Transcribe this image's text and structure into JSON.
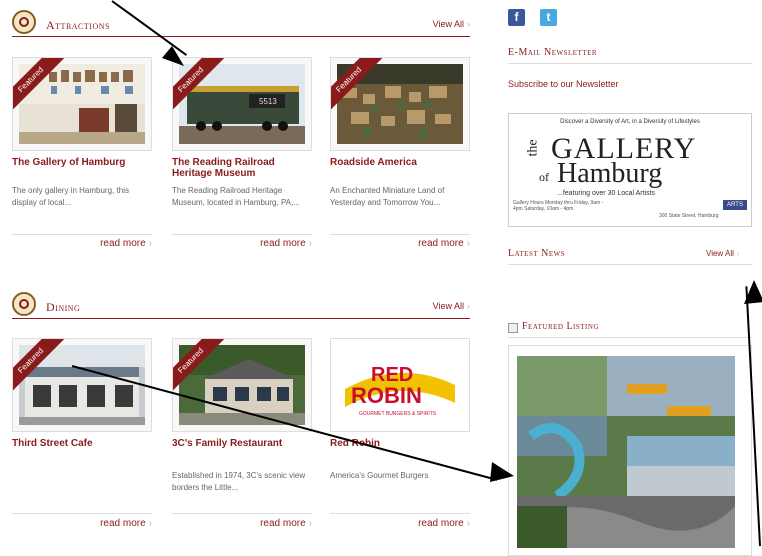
{
  "attractions": {
    "title": "Attractions",
    "view_all": "View All",
    "items": [
      {
        "badge": "Featured",
        "title": "The Gallery of Hamburg",
        "desc": "The only gallery in Hamburg, this display of local...",
        "read_more": "read more"
      },
      {
        "badge": "Featured",
        "title": "The Reading Railroad Heritage Museum",
        "desc": "The Reading Railroad Heritage Museum, located in Hamburg, PA,...",
        "read_more": "read more",
        "engine_number": "5513"
      },
      {
        "badge": "Featured",
        "title": "Roadside America",
        "desc": "An Enchanted Miniature Land of Yesterday and Tomorrow You...",
        "read_more": "read more"
      }
    ]
  },
  "dining": {
    "title": "Dining",
    "view_all": "View All",
    "items": [
      {
        "badge": "Featured",
        "title": "Third Street Cafe",
        "desc": "",
        "read_more": "read more"
      },
      {
        "badge": "Featured",
        "title": "3C's Family Restaurant",
        "desc": "Established in 1974, 3C's scenic view borders the Little...",
        "read_more": "read more"
      },
      {
        "badge": "",
        "title": "Red Robin",
        "desc": "America's Gourmet Burgers",
        "read_more": "read more",
        "logo_line1": "RED",
        "logo_line2": "ROBIN",
        "logo_sub": "GOURMET BURGERS & SPIRITS"
      }
    ]
  },
  "sidebar": {
    "newsletter_title": "E-Mail Newsletter",
    "subscribe": "Subscribe to our Newsletter",
    "ad": {
      "tagline": "Discover a Diversity of Art, in a Diversity of Lifestyles",
      "the": "the",
      "gallery": "GALLERY",
      "of": "of",
      "hamburg": "Hamburg",
      "artists": "...featuring over 30 Local Artists",
      "hours": "Gallery Hours Monday thru Friday, 9am - 4pm Saturday, 10am - 4pm",
      "address": "300 State Street, Hamburg",
      "arts_badge": "ARTS"
    },
    "latest_news": "Latest News",
    "news_view_all": "View All",
    "featured_listing": "Featured Listing"
  },
  "colors": {
    "accent": "#8a1b1b",
    "facebook": "#3b5998",
    "twitter": "#4aa8e0"
  }
}
